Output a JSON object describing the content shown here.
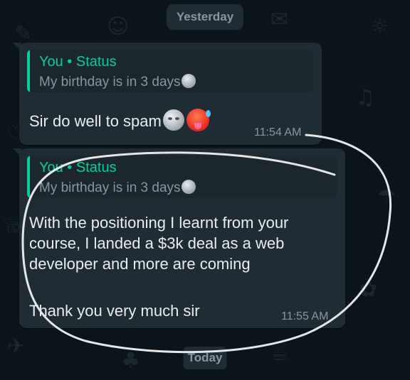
{
  "chat": {
    "date_yesterday": "Yesterday",
    "date_today": "Today",
    "messages": [
      {
        "quote_author": "You",
        "quote_separator": "•",
        "quote_type": "Status",
        "quote_title": "You • Status",
        "quote_text": "My birthday is in 3 days",
        "text": "Sir do well to spam",
        "emojis": [
          "moon-face-emoji",
          "hot-face-emoji"
        ],
        "time": "11:54 AM"
      },
      {
        "quote_title": "You • Status",
        "quote_text": "My birthday is in 3 days",
        "text_line_1": "With the positioning I learnt from your",
        "text_line_2": "course, I landed a $3k deal as a web",
        "text_line_3": "developer and more are coming",
        "text_line_4": "Thank you very much sir",
        "time": "11:55 AM"
      }
    ]
  },
  "colors": {
    "background": "#0b141a",
    "bubble": "#1f2c33",
    "accent": "#06cf9c",
    "text": "#e9edef",
    "meta": "#8696a0",
    "annotation_stroke": "#e6e6e6"
  }
}
